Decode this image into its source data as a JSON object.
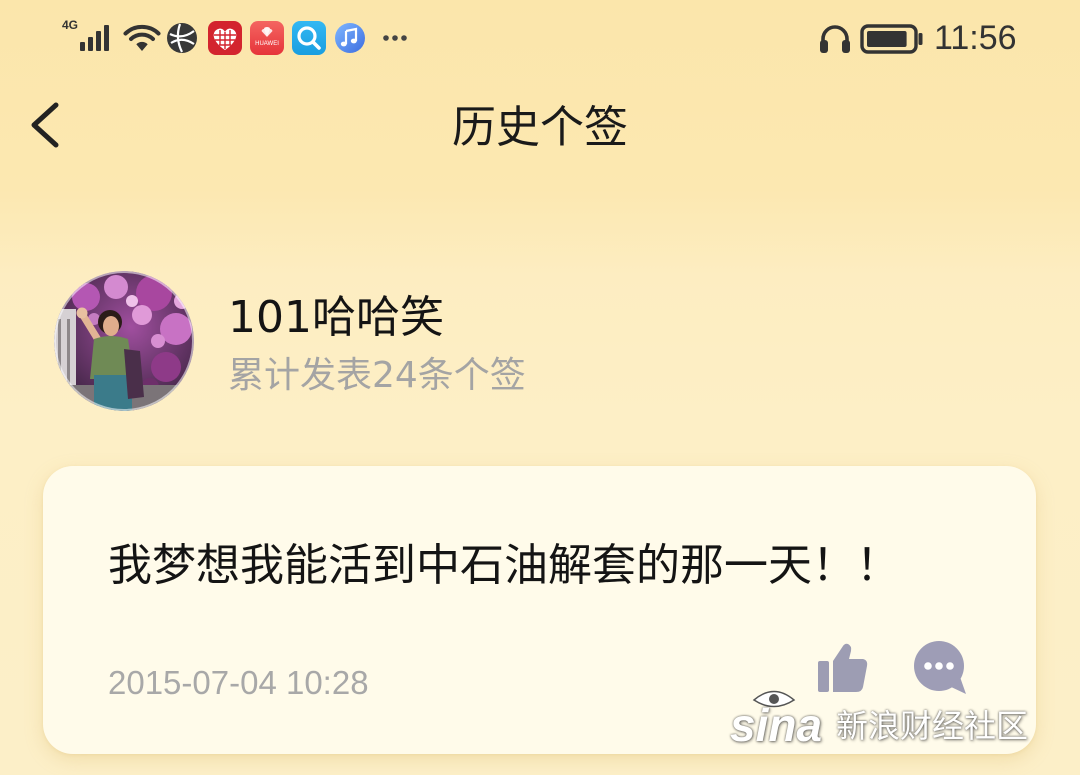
{
  "status_bar": {
    "network_type": "4G",
    "signal_level": 4,
    "signal_max": 4,
    "time": "11:56",
    "battery_level": 0.9,
    "huawei_app_label": "HUAWEI",
    "left_icons": [
      "signal-icon",
      "wifi-icon",
      "globe-app-icon",
      "red-heart-app-icon",
      "huawei-mall-app-icon",
      "search-app-icon",
      "music-app-icon",
      "more-notifications-icon"
    ],
    "right_icons": [
      "headphones-icon",
      "battery-icon"
    ]
  },
  "header": {
    "back_icon": "chevron-left-icon",
    "title": "历史个签"
  },
  "profile": {
    "name": "101哈哈笑",
    "summary": "累计发表24条个签"
  },
  "signatures": [
    {
      "text": "我梦想我能活到中石油解套的那一天！！",
      "timestamp": "2015-07-04 10:28",
      "like_icon": "thumbs-up-icon",
      "comment_icon": "comment-bubble-icon"
    }
  ],
  "watermark": {
    "logo": "sina",
    "text": "新浪财经社区"
  },
  "colors": {
    "background": "#fce8b1",
    "card": "#fffbea",
    "primary_text": "#1a1a1a",
    "muted_text": "#a6a6a6",
    "action_icon": "#9d9db3"
  }
}
